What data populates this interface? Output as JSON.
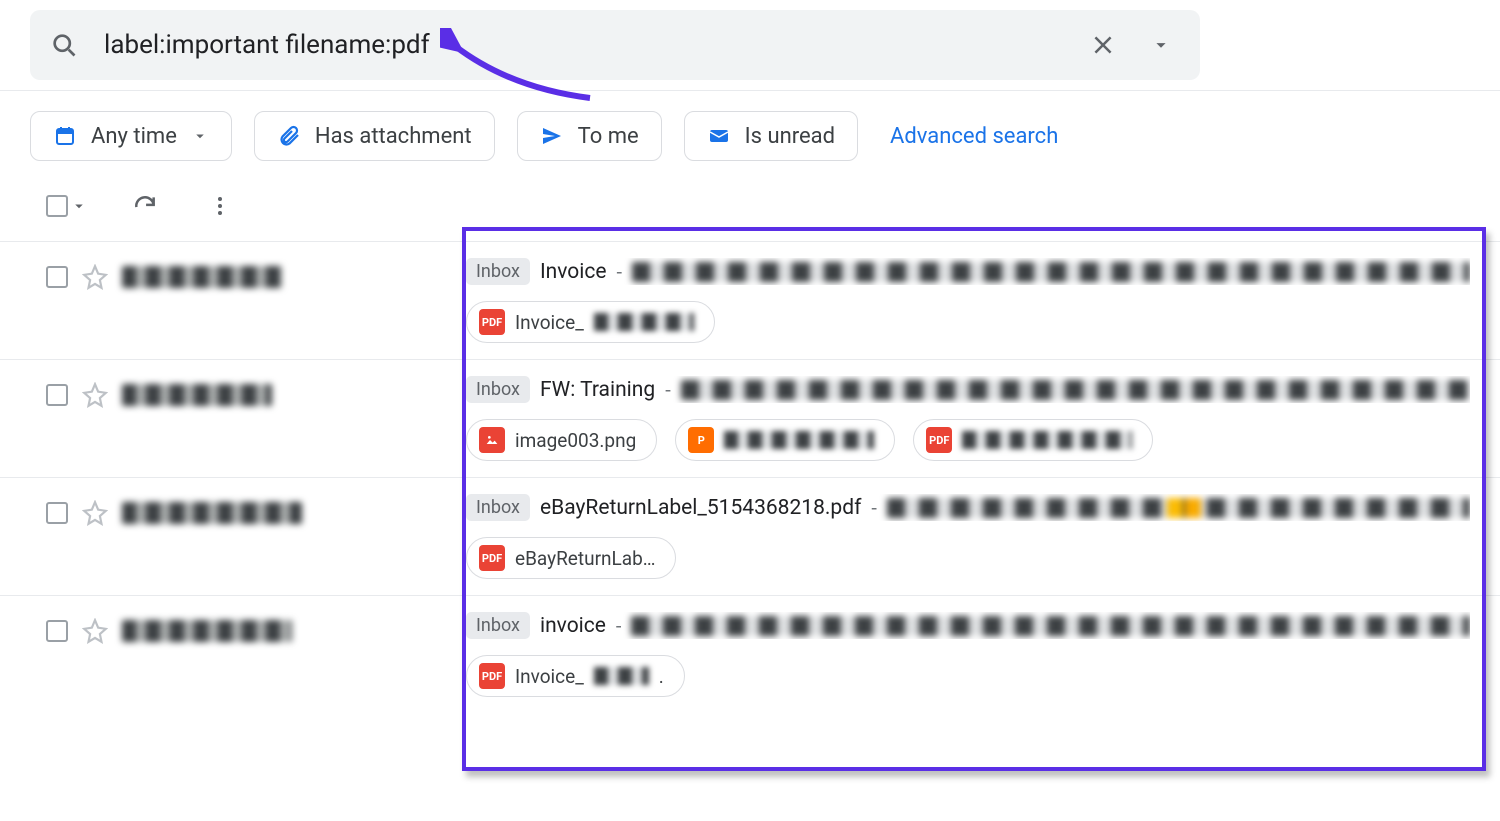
{
  "search": {
    "query": "label:important filename:pdf"
  },
  "filters": {
    "any_time": "Any time",
    "has_attachment": "Has attachment",
    "to_me": "To me",
    "is_unread": "Is unread",
    "advanced": "Advanced search"
  },
  "label": "Inbox",
  "rows": [
    {
      "subject": "Invoice",
      "attachments": [
        {
          "type": "pdf",
          "name_prefix": "Invoice_",
          "blurred": true
        }
      ]
    },
    {
      "subject": "FW: Training",
      "attachments": [
        {
          "type": "img",
          "name": "image003.png"
        },
        {
          "type": "ppt",
          "blurred": true
        },
        {
          "type": "pdf",
          "blurred": true
        }
      ]
    },
    {
      "subject": "eBayReturnLabel_5154368218.pdf",
      "attachments": [
        {
          "type": "pdf",
          "name": "eBayReturnLab…"
        }
      ]
    },
    {
      "subject": "invoice",
      "attachments": [
        {
          "type": "pdf",
          "name_prefix": "Invoice_",
          "blurred": true
        }
      ]
    }
  ],
  "colors": {
    "annotation": "#5a2ee6"
  }
}
